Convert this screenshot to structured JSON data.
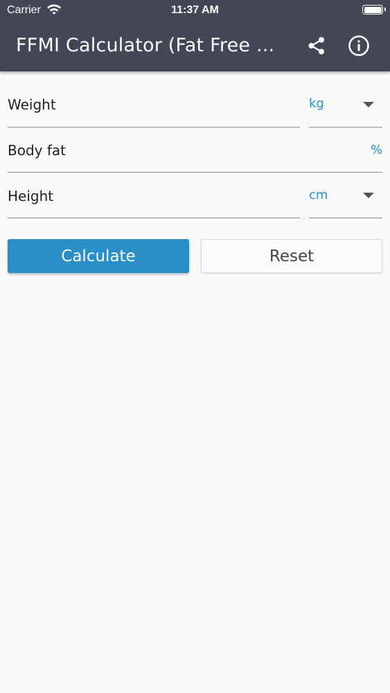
{
  "status_bar": {
    "carrier": "Carrier",
    "time": "11:37 AM"
  },
  "app_bar": {
    "title": "FFMI Calculator (Fat Free ...",
    "share_icon": "share-icon",
    "info_icon": "info-icon"
  },
  "form": {
    "weight": {
      "label": "Weight",
      "unit": "kg"
    },
    "body_fat": {
      "label": "Body fat",
      "unit": "%"
    },
    "height": {
      "label": "Height",
      "unit": "cm"
    }
  },
  "buttons": {
    "calculate": "Calculate",
    "reset": "Reset"
  },
  "colors": {
    "app_bar": "#434654",
    "accent": "#2a8fc6",
    "unit_text": "#2d8fc7"
  }
}
